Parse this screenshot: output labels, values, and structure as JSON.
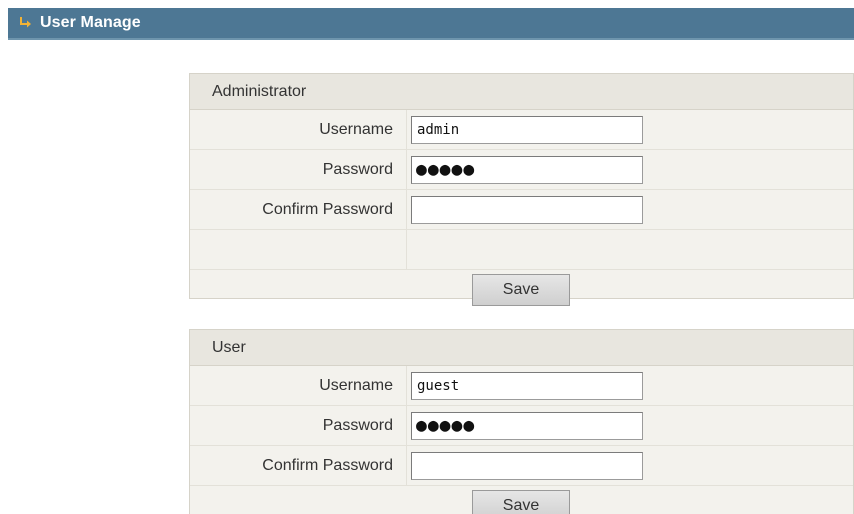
{
  "header": {
    "title": "User Manage",
    "icon": "arrow-right-icon"
  },
  "administrator": {
    "section_title": "Administrator",
    "username_label": "Username",
    "username_value": "admin",
    "password_label": "Password",
    "password_value": "●●●●●",
    "confirm_label": "Confirm Password",
    "confirm_value": "",
    "save_label": "Save"
  },
  "user": {
    "section_title": "User",
    "username_label": "Username",
    "username_value": "guest",
    "password_label": "Password",
    "password_value": "●●●●●",
    "confirm_label": "Confirm Password",
    "confirm_value": "",
    "save_label": "Save"
  },
  "colors": {
    "header_bg": "#4d7794",
    "panel_bg": "#f3f2ed",
    "panel_header_bg": "#e8e6df",
    "arrow_icon": "#f2b234"
  }
}
